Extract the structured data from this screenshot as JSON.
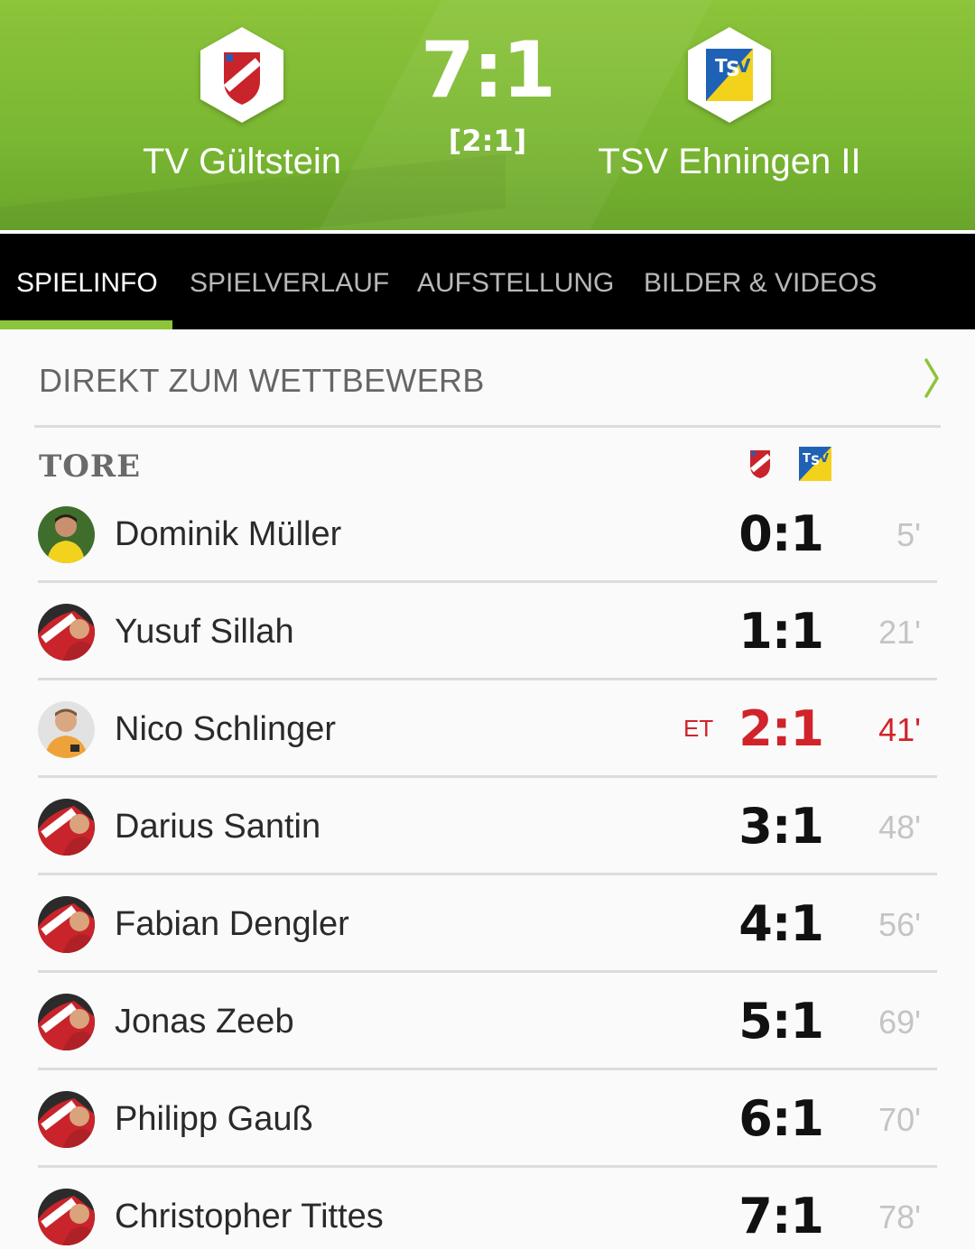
{
  "match": {
    "home_team": "TV Gültstein",
    "away_team": "TSV Ehningen II",
    "score": "7:1",
    "halftime": "[2:1]",
    "home_crest_letters": "TV Gültstein",
    "away_crest_letters": "TSV"
  },
  "tabs": [
    {
      "label": "SPIELINFO",
      "active": true
    },
    {
      "label": "SPIELVERLAUF",
      "active": false
    },
    {
      "label": "AUFSTELLUNG",
      "active": false
    },
    {
      "label": "BILDER & VIDEOS",
      "active": false
    }
  ],
  "competition_link": {
    "label": "DIREKT ZUM WETTBEWERB",
    "icon": "chevron-right-icon"
  },
  "goals_section": {
    "title": "TORE"
  },
  "goals": [
    {
      "player": "Dominik Müller",
      "score": "0:1",
      "minute": "5'",
      "own_goal": "",
      "highlight": false
    },
    {
      "player": "Yusuf Sillah",
      "score": "1:1",
      "minute": "21'",
      "own_goal": "",
      "highlight": false
    },
    {
      "player": "Nico Schlinger",
      "score": "2:1",
      "minute": "41'",
      "own_goal": "ET",
      "highlight": true
    },
    {
      "player": "Darius Santin",
      "score": "3:1",
      "minute": "48'",
      "own_goal": "",
      "highlight": false
    },
    {
      "player": "Fabian Dengler",
      "score": "4:1",
      "minute": "56'",
      "own_goal": "",
      "highlight": false
    },
    {
      "player": "Jonas Zeeb",
      "score": "5:1",
      "minute": "69'",
      "own_goal": "",
      "highlight": false
    },
    {
      "player": "Philipp Gauß",
      "score": "6:1",
      "minute": "70'",
      "own_goal": "",
      "highlight": false
    },
    {
      "player": "Christopher Tittes",
      "score": "7:1",
      "minute": "78'",
      "own_goal": "",
      "highlight": false
    }
  ],
  "colors": {
    "header_green": "#8cc43a",
    "tab_bar": "#000000",
    "own_goal_red": "#d0232a"
  }
}
